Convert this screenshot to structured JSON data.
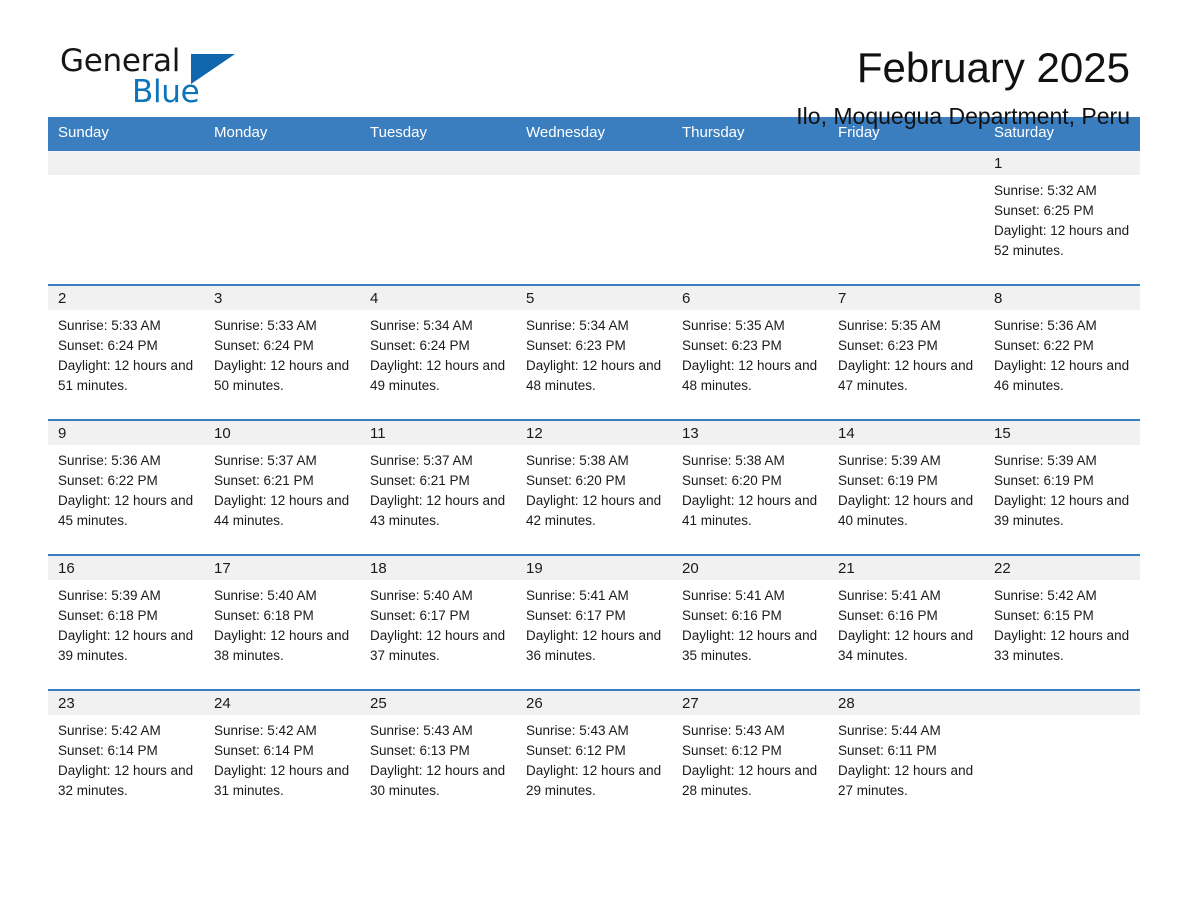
{
  "brand": {
    "name_part1": "General",
    "name_part2": "Blue",
    "triangle_color": "#1167ae",
    "blue_color": "#0d74bb"
  },
  "header": {
    "title": "February 2025",
    "subtitle": "Ilo, Moquegua Department, Peru"
  },
  "theme": {
    "header_blue": "#3b7ec0",
    "daynum_band": "#f1f1f1",
    "text": "#1a1a1a"
  },
  "weekday_headers": [
    "Sunday",
    "Monday",
    "Tuesday",
    "Wednesday",
    "Thursday",
    "Friday",
    "Saturday"
  ],
  "weeks": [
    [
      {
        "day": ""
      },
      {
        "day": ""
      },
      {
        "day": ""
      },
      {
        "day": ""
      },
      {
        "day": ""
      },
      {
        "day": ""
      },
      {
        "day": "1",
        "sunrise": "Sunrise: 5:32 AM",
        "sunset": "Sunset: 6:25 PM",
        "daylight": "Daylight: 12 hours and 52 minutes."
      }
    ],
    [
      {
        "day": "2",
        "sunrise": "Sunrise: 5:33 AM",
        "sunset": "Sunset: 6:24 PM",
        "daylight": "Daylight: 12 hours and 51 minutes."
      },
      {
        "day": "3",
        "sunrise": "Sunrise: 5:33 AM",
        "sunset": "Sunset: 6:24 PM",
        "daylight": "Daylight: 12 hours and 50 minutes."
      },
      {
        "day": "4",
        "sunrise": "Sunrise: 5:34 AM",
        "sunset": "Sunset: 6:24 PM",
        "daylight": "Daylight: 12 hours and 49 minutes."
      },
      {
        "day": "5",
        "sunrise": "Sunrise: 5:34 AM",
        "sunset": "Sunset: 6:23 PM",
        "daylight": "Daylight: 12 hours and 48 minutes."
      },
      {
        "day": "6",
        "sunrise": "Sunrise: 5:35 AM",
        "sunset": "Sunset: 6:23 PM",
        "daylight": "Daylight: 12 hours and 48 minutes."
      },
      {
        "day": "7",
        "sunrise": "Sunrise: 5:35 AM",
        "sunset": "Sunset: 6:23 PM",
        "daylight": "Daylight: 12 hours and 47 minutes."
      },
      {
        "day": "8",
        "sunrise": "Sunrise: 5:36 AM",
        "sunset": "Sunset: 6:22 PM",
        "daylight": "Daylight: 12 hours and 46 minutes."
      }
    ],
    [
      {
        "day": "9",
        "sunrise": "Sunrise: 5:36 AM",
        "sunset": "Sunset: 6:22 PM",
        "daylight": "Daylight: 12 hours and 45 minutes."
      },
      {
        "day": "10",
        "sunrise": "Sunrise: 5:37 AM",
        "sunset": "Sunset: 6:21 PM",
        "daylight": "Daylight: 12 hours and 44 minutes."
      },
      {
        "day": "11",
        "sunrise": "Sunrise: 5:37 AM",
        "sunset": "Sunset: 6:21 PM",
        "daylight": "Daylight: 12 hours and 43 minutes."
      },
      {
        "day": "12",
        "sunrise": "Sunrise: 5:38 AM",
        "sunset": "Sunset: 6:20 PM",
        "daylight": "Daylight: 12 hours and 42 minutes."
      },
      {
        "day": "13",
        "sunrise": "Sunrise: 5:38 AM",
        "sunset": "Sunset: 6:20 PM",
        "daylight": "Daylight: 12 hours and 41 minutes."
      },
      {
        "day": "14",
        "sunrise": "Sunrise: 5:39 AM",
        "sunset": "Sunset: 6:19 PM",
        "daylight": "Daylight: 12 hours and 40 minutes."
      },
      {
        "day": "15",
        "sunrise": "Sunrise: 5:39 AM",
        "sunset": "Sunset: 6:19 PM",
        "daylight": "Daylight: 12 hours and 39 minutes."
      }
    ],
    [
      {
        "day": "16",
        "sunrise": "Sunrise: 5:39 AM",
        "sunset": "Sunset: 6:18 PM",
        "daylight": "Daylight: 12 hours and 39 minutes."
      },
      {
        "day": "17",
        "sunrise": "Sunrise: 5:40 AM",
        "sunset": "Sunset: 6:18 PM",
        "daylight": "Daylight: 12 hours and 38 minutes."
      },
      {
        "day": "18",
        "sunrise": "Sunrise: 5:40 AM",
        "sunset": "Sunset: 6:17 PM",
        "daylight": "Daylight: 12 hours and 37 minutes."
      },
      {
        "day": "19",
        "sunrise": "Sunrise: 5:41 AM",
        "sunset": "Sunset: 6:17 PM",
        "daylight": "Daylight: 12 hours and 36 minutes."
      },
      {
        "day": "20",
        "sunrise": "Sunrise: 5:41 AM",
        "sunset": "Sunset: 6:16 PM",
        "daylight": "Daylight: 12 hours and 35 minutes."
      },
      {
        "day": "21",
        "sunrise": "Sunrise: 5:41 AM",
        "sunset": "Sunset: 6:16 PM",
        "daylight": "Daylight: 12 hours and 34 minutes."
      },
      {
        "day": "22",
        "sunrise": "Sunrise: 5:42 AM",
        "sunset": "Sunset: 6:15 PM",
        "daylight": "Daylight: 12 hours and 33 minutes."
      }
    ],
    [
      {
        "day": "23",
        "sunrise": "Sunrise: 5:42 AM",
        "sunset": "Sunset: 6:14 PM",
        "daylight": "Daylight: 12 hours and 32 minutes."
      },
      {
        "day": "24",
        "sunrise": "Sunrise: 5:42 AM",
        "sunset": "Sunset: 6:14 PM",
        "daylight": "Daylight: 12 hours and 31 minutes."
      },
      {
        "day": "25",
        "sunrise": "Sunrise: 5:43 AM",
        "sunset": "Sunset: 6:13 PM",
        "daylight": "Daylight: 12 hours and 30 minutes."
      },
      {
        "day": "26",
        "sunrise": "Sunrise: 5:43 AM",
        "sunset": "Sunset: 6:12 PM",
        "daylight": "Daylight: 12 hours and 29 minutes."
      },
      {
        "day": "27",
        "sunrise": "Sunrise: 5:43 AM",
        "sunset": "Sunset: 6:12 PM",
        "daylight": "Daylight: 12 hours and 28 minutes."
      },
      {
        "day": "28",
        "sunrise": "Sunrise: 5:44 AM",
        "sunset": "Sunset: 6:11 PM",
        "daylight": "Daylight: 12 hours and 27 minutes."
      },
      {
        "day": ""
      }
    ]
  ]
}
